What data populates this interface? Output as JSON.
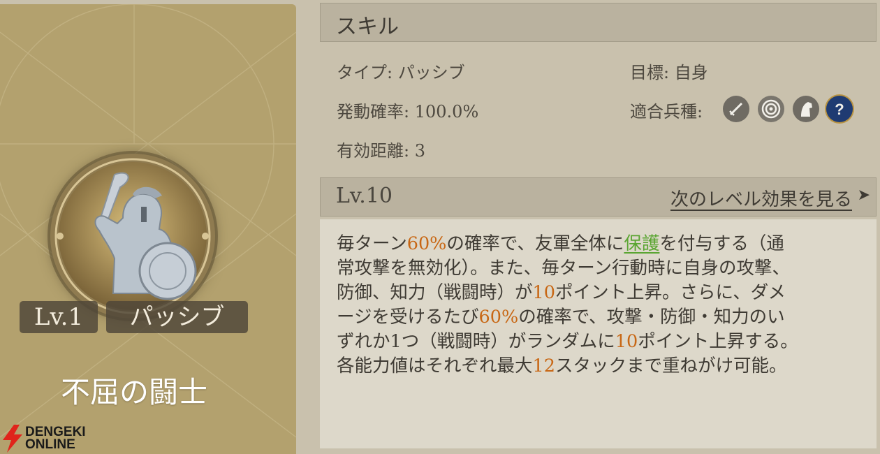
{
  "skill_card": {
    "level": "Lv.1",
    "type": "パッシブ",
    "name": "不屈の闘士",
    "portrait_icon": "spartan-warrior-icon"
  },
  "header": {
    "title": "スキル"
  },
  "info": {
    "type_label": "タイプ:",
    "type_value": "パッシブ",
    "chance_label": "発動確率:",
    "chance_value": "100.0%",
    "range_label": "有効距離:",
    "range_value": "3",
    "target_label": "目標:",
    "target_value": "自身",
    "troop_label": "適合兵種:",
    "troop_icons": [
      "sword-icon",
      "bow-target-icon",
      "cavalry-horse-icon",
      "question-icon"
    ]
  },
  "level_bar": {
    "level": "Lv.10",
    "next_label": "次のレベル効果を見る",
    "next_arrow": "➤"
  },
  "description": {
    "l1a": "毎ターン",
    "l1b": "60%",
    "l1c": "の確率で、友軍全体に",
    "l1d": "保護",
    "l1e": "を付与する（通",
    "l2": "常攻撃を無効化）。また、毎ターン行動時に自身の攻撃、",
    "l3a": "防御、知力（戦闘時）が",
    "l3b": "10",
    "l3c": "ポイント上昇。さらに、ダメ",
    "l4a": "ージを受けるたび",
    "l4b": "60%",
    "l4c": "の確率で、攻撃・防御・知力のい",
    "l5a": "ずれか1つ（戦闘時）がランダムに",
    "l5b": "10",
    "l5c": "ポイント上昇する。",
    "l6a": "各能力値はそれぞれ最大",
    "l6b": "12",
    "l6c": "スタックまで重ねがけ可能。"
  },
  "watermark": {
    "line1": "DENGEKI",
    "line2": "ONLINE"
  },
  "colors": {
    "highlight": "#c86714",
    "keyword": "#5aa532",
    "card": "#b3a16e"
  }
}
